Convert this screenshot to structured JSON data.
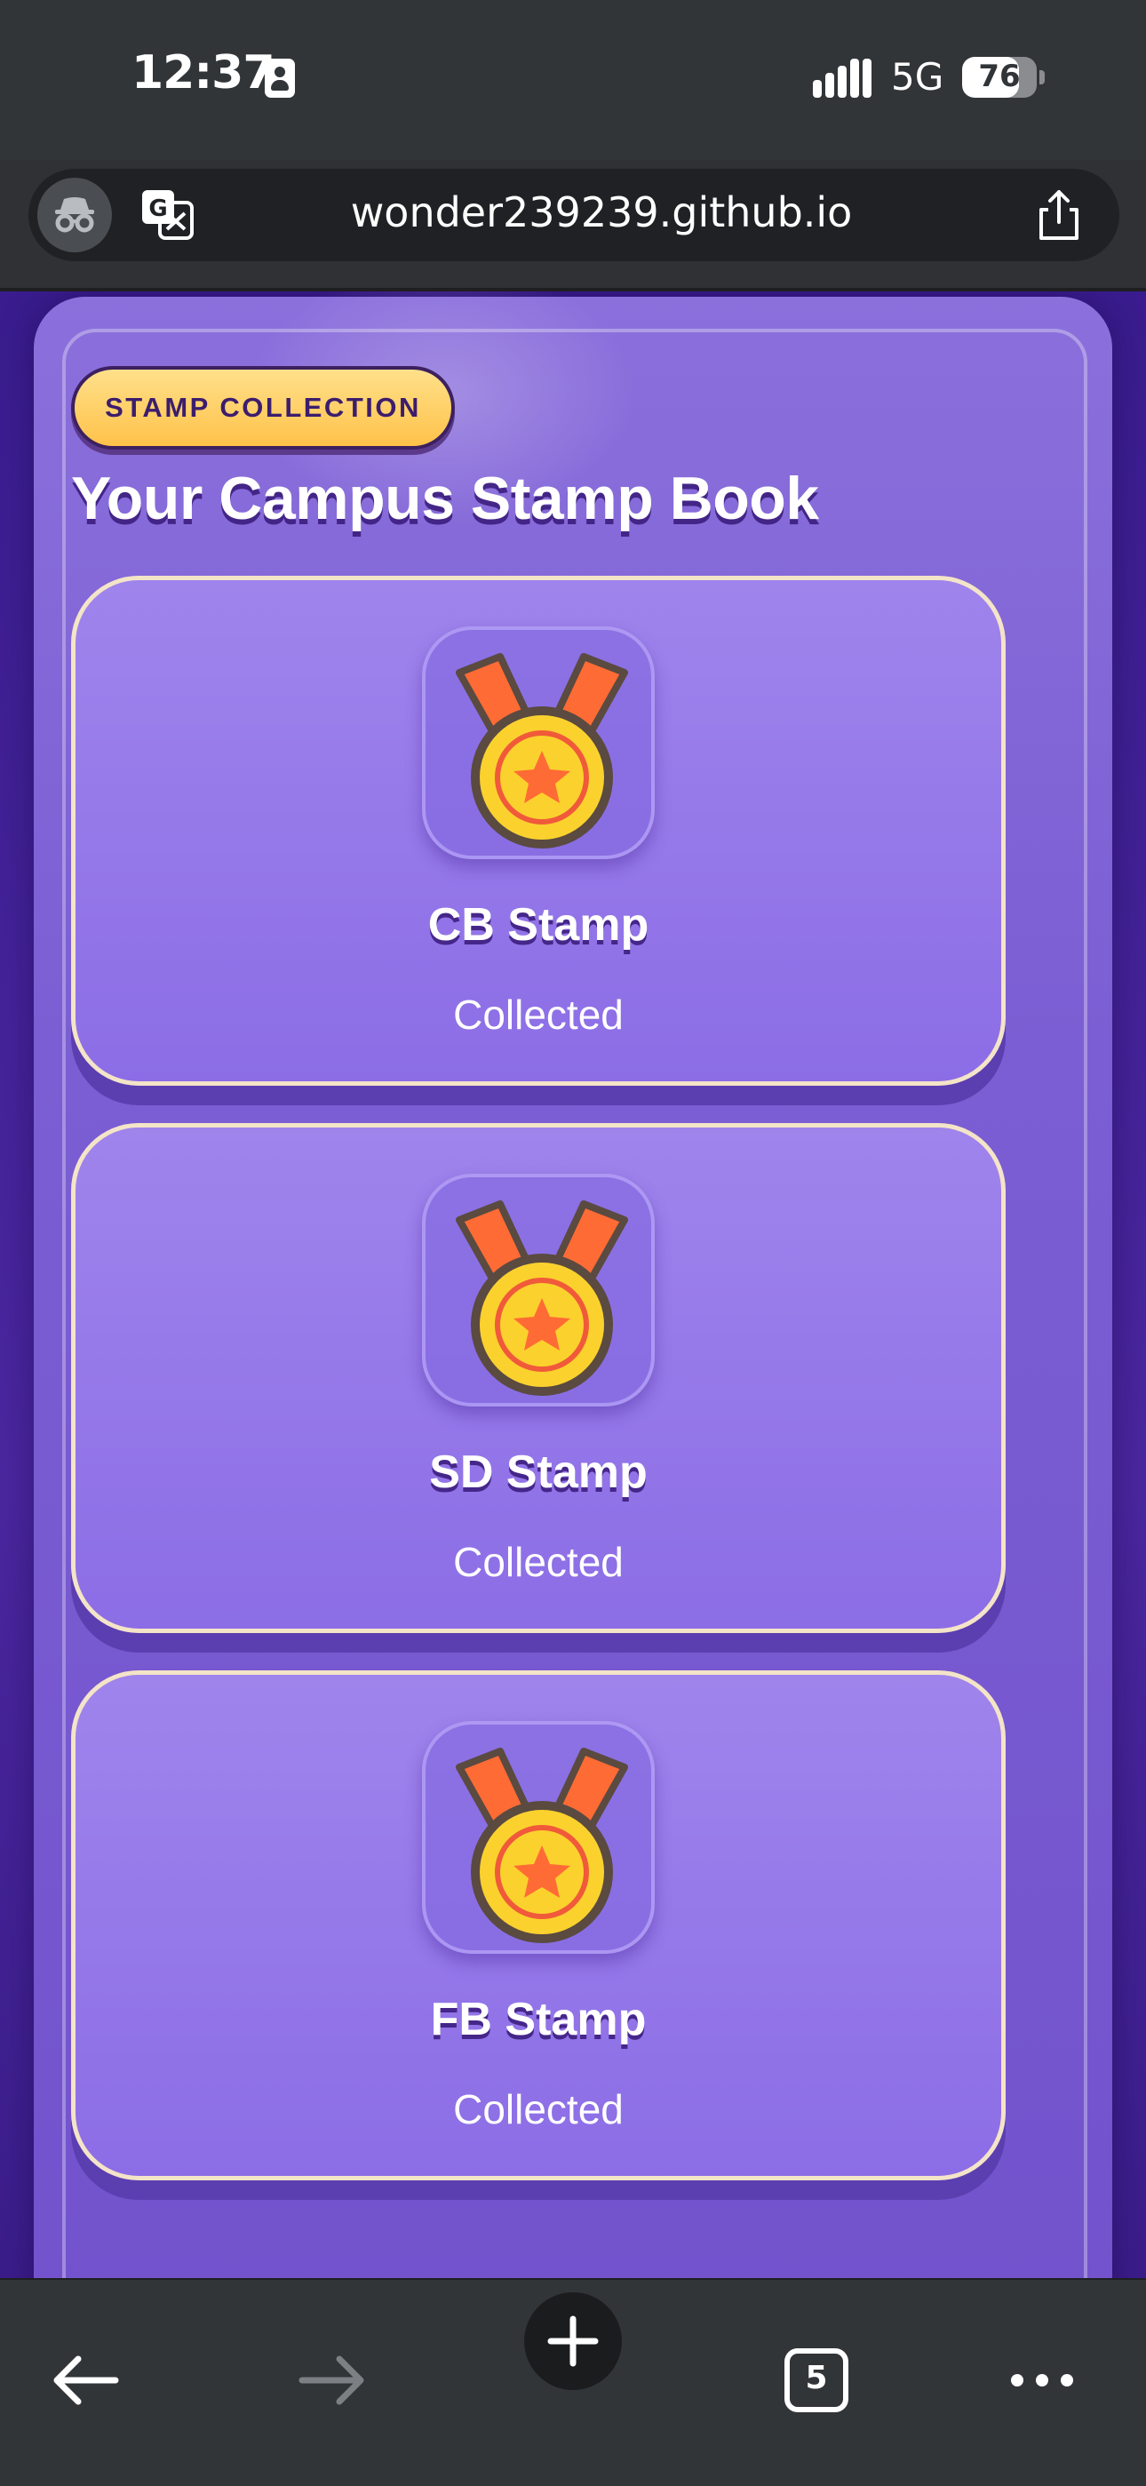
{
  "status_bar": {
    "time": "12:37",
    "network": "5G",
    "battery": "76",
    "battery_level": 0.76
  },
  "browser": {
    "url": "wonder239239.github.io",
    "tab_count": "5"
  },
  "page": {
    "badge": "STAMP COLLECTION",
    "title": "Your Campus Stamp Book",
    "stamps": [
      {
        "name": "CB Stamp",
        "status": "Collected",
        "icon": "medal-icon"
      },
      {
        "name": "SD Stamp",
        "status": "Collected",
        "icon": "medal-icon"
      },
      {
        "name": "FB Stamp",
        "status": "Collected",
        "icon": "medal-icon"
      }
    ]
  },
  "colors": {
    "panel": "#7b5ed3",
    "card": "#9277e8",
    "card_border": "#f4e4c8",
    "badge": "#ffd46b",
    "medal_gold": "#fbd12e",
    "ribbon": "#ff6b35"
  }
}
